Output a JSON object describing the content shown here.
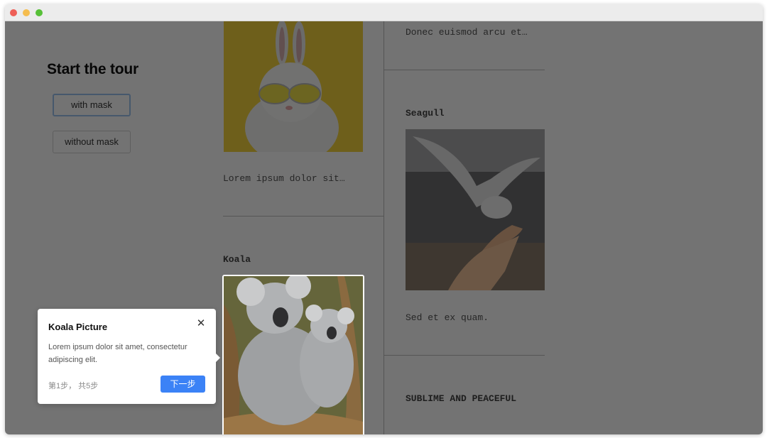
{
  "page": {
    "title": "Start the tour",
    "buttons": {
      "with_mask": "with mask",
      "without_mask": "without mask"
    }
  },
  "cards": {
    "rabbit_caption": "Lorem ipsum dolor sit…",
    "koala_title": "Koala",
    "top_right_caption": "Donec euismod arcu et…",
    "seagull_title": "Seagull",
    "seagull_caption": "Sed et ex quam.",
    "sublime_title": "SUBLIME AND PEACEFUL"
  },
  "tour": {
    "title": "Koala Picture",
    "description": "Lorem ipsum dolor sit amet, consectetur adipiscing elit.",
    "step_text": "第1步， 共5步",
    "next_label": "下一步",
    "close_icon": "close-icon"
  },
  "colors": {
    "primary_button": "#3b82f6",
    "mask": "rgba(0,0,0,0.55)"
  }
}
